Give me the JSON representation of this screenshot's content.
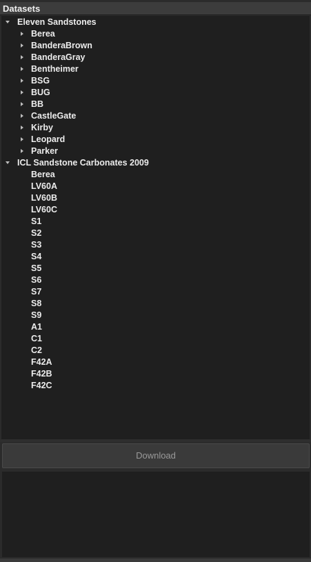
{
  "header": {
    "title": "Datasets"
  },
  "tree": {
    "groups": [
      {
        "label": "Eleven Sandstones",
        "expanded": true,
        "children": [
          "Berea",
          "BanderaBrown",
          "BanderaGray",
          "Bentheimer",
          "BSG",
          "BUG",
          "BB",
          "CastleGate",
          "Kirby",
          "Leopard",
          "Parker"
        ]
      },
      {
        "label": "ICL Sandstone Carbonates 2009",
        "expanded": true,
        "children": [
          "Berea",
          "LV60A",
          "LV60B",
          "LV60C",
          "S1",
          "S2",
          "S3",
          "S4",
          "S5",
          "S6",
          "S7",
          "S8",
          "S9",
          "A1",
          "C1",
          "C2",
          "F42A",
          "F42B",
          "F42C"
        ]
      }
    ]
  },
  "download_button": {
    "label": "Download"
  },
  "colors": {
    "background": "#2b2b2b",
    "tree_background": "#1f1f1f",
    "text": "#ececec",
    "button_text": "#9a9a9a"
  }
}
